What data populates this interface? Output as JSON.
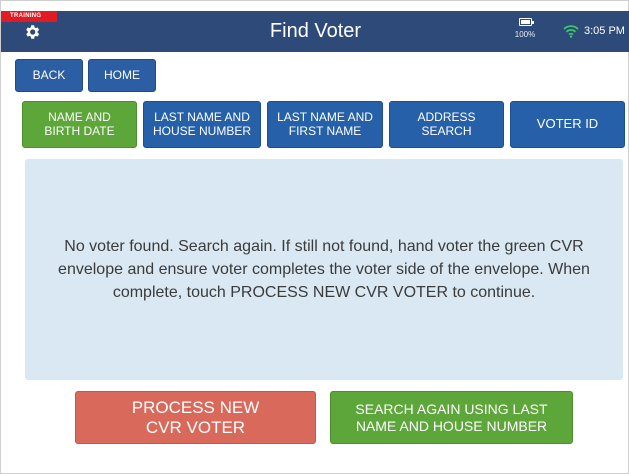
{
  "status_bar": {
    "training_label": "TRAINING",
    "title": "Find Voter",
    "battery_percent": "100%",
    "time": "3:05 PM",
    "icons": [
      "gear-icon",
      "battery-icon",
      "wifi-icon"
    ]
  },
  "nav": {
    "back_label": "BACK",
    "home_label": "HOME"
  },
  "tabs": [
    {
      "label_line1": "NAME AND",
      "label_line2": "BIRTH DATE",
      "active": true
    },
    {
      "label_line1": "LAST NAME AND",
      "label_line2": "HOUSE NUMBER",
      "active": false
    },
    {
      "label_line1": "LAST NAME AND",
      "label_line2": "FIRST NAME",
      "active": false
    },
    {
      "label_line1": "ADDRESS",
      "label_line2": "SEARCH",
      "active": false
    },
    {
      "label_line1": "VOTER ID",
      "label_line2": "",
      "active": false
    }
  ],
  "message": "No voter found. Search again. If still not found, hand voter the green CVR envelope and ensure voter completes the voter side of the envelope. When complete, touch PROCESS NEW CVR VOTER to continue.",
  "actions": {
    "process_line1": "PROCESS NEW",
    "process_line2": "CVR VOTER",
    "search_line1": "SEARCH AGAIN USING LAST",
    "search_line2": "NAME AND HOUSE NUMBER"
  },
  "colors": {
    "header": "#2e4a78",
    "tab_blue": "#2560a8",
    "tab_active_green": "#5da63a",
    "panel": "#d9e8f2",
    "process_red": "#d9695a",
    "training_red": "#e01b24"
  }
}
